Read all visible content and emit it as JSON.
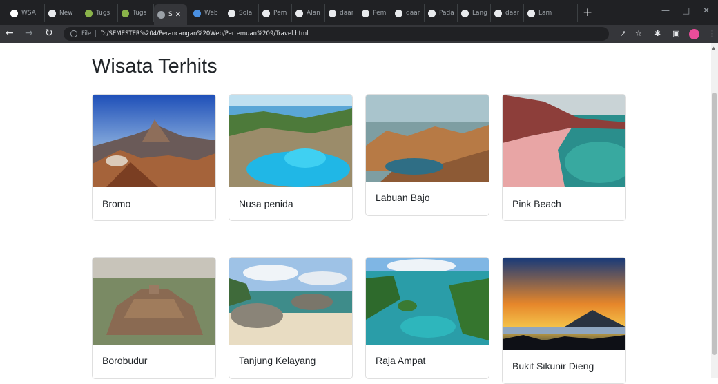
{
  "browser": {
    "tabs": [
      {
        "title": "WSA",
        "icon_color": "#ffffff"
      },
      {
        "title": "New",
        "icon_color": "#e8eaed"
      },
      {
        "title": "Tugs",
        "icon_color": "#8ab34a"
      },
      {
        "title": "Tugs",
        "icon_color": "#8ab34a"
      },
      {
        "title": "S",
        "icon_color": "#9aa0a6"
      },
      {
        "title": "Web",
        "icon_color": "#4a90e2"
      },
      {
        "title": "Sola",
        "icon_color": "#e8eaed"
      },
      {
        "title": "Pem",
        "icon_color": "#e8eaed"
      },
      {
        "title": "Alan",
        "icon_color": "#e8eaed"
      },
      {
        "title": "daar",
        "icon_color": "#e8eaed"
      },
      {
        "title": "Pem",
        "icon_color": "#e8eaed"
      },
      {
        "title": "daar",
        "icon_color": "#e8eaed"
      },
      {
        "title": "Pada",
        "icon_color": "#e8eaed"
      },
      {
        "title": "Lang",
        "icon_color": "#e8eaed"
      },
      {
        "title": "daar",
        "icon_color": "#e8eaed"
      },
      {
        "title": "Lam",
        "icon_color": "#e8eaed"
      }
    ],
    "active_tab_index": 4,
    "new_tab_label": "+",
    "close_label": "✕",
    "protocol_label": "File",
    "url": "D:/SEMESTER%204/Perancangan%20Web/Pertemuan%209/Travel.html"
  },
  "page": {
    "heading": "Wisata Terhits",
    "cards": [
      {
        "title": "Bromo",
        "scene": "bromo"
      },
      {
        "title": "Nusa penida",
        "scene": "nusa"
      },
      {
        "title": "Labuan Bajo",
        "scene": "labuan"
      },
      {
        "title": "Pink Beach",
        "scene": "pink"
      },
      {
        "title": "Borobudur",
        "scene": "borobudur"
      },
      {
        "title": "Tanjung Kelayang",
        "scene": "tanjung"
      },
      {
        "title": "Raja Ampat",
        "scene": "raja"
      },
      {
        "title": "Bukit Sikunir Dieng",
        "scene": "sikunir"
      }
    ]
  },
  "colors": {
    "chrome_dark": "#202124",
    "chrome_toolbar": "#35363a",
    "profile": "#ea4d9a",
    "text": "#212529"
  }
}
